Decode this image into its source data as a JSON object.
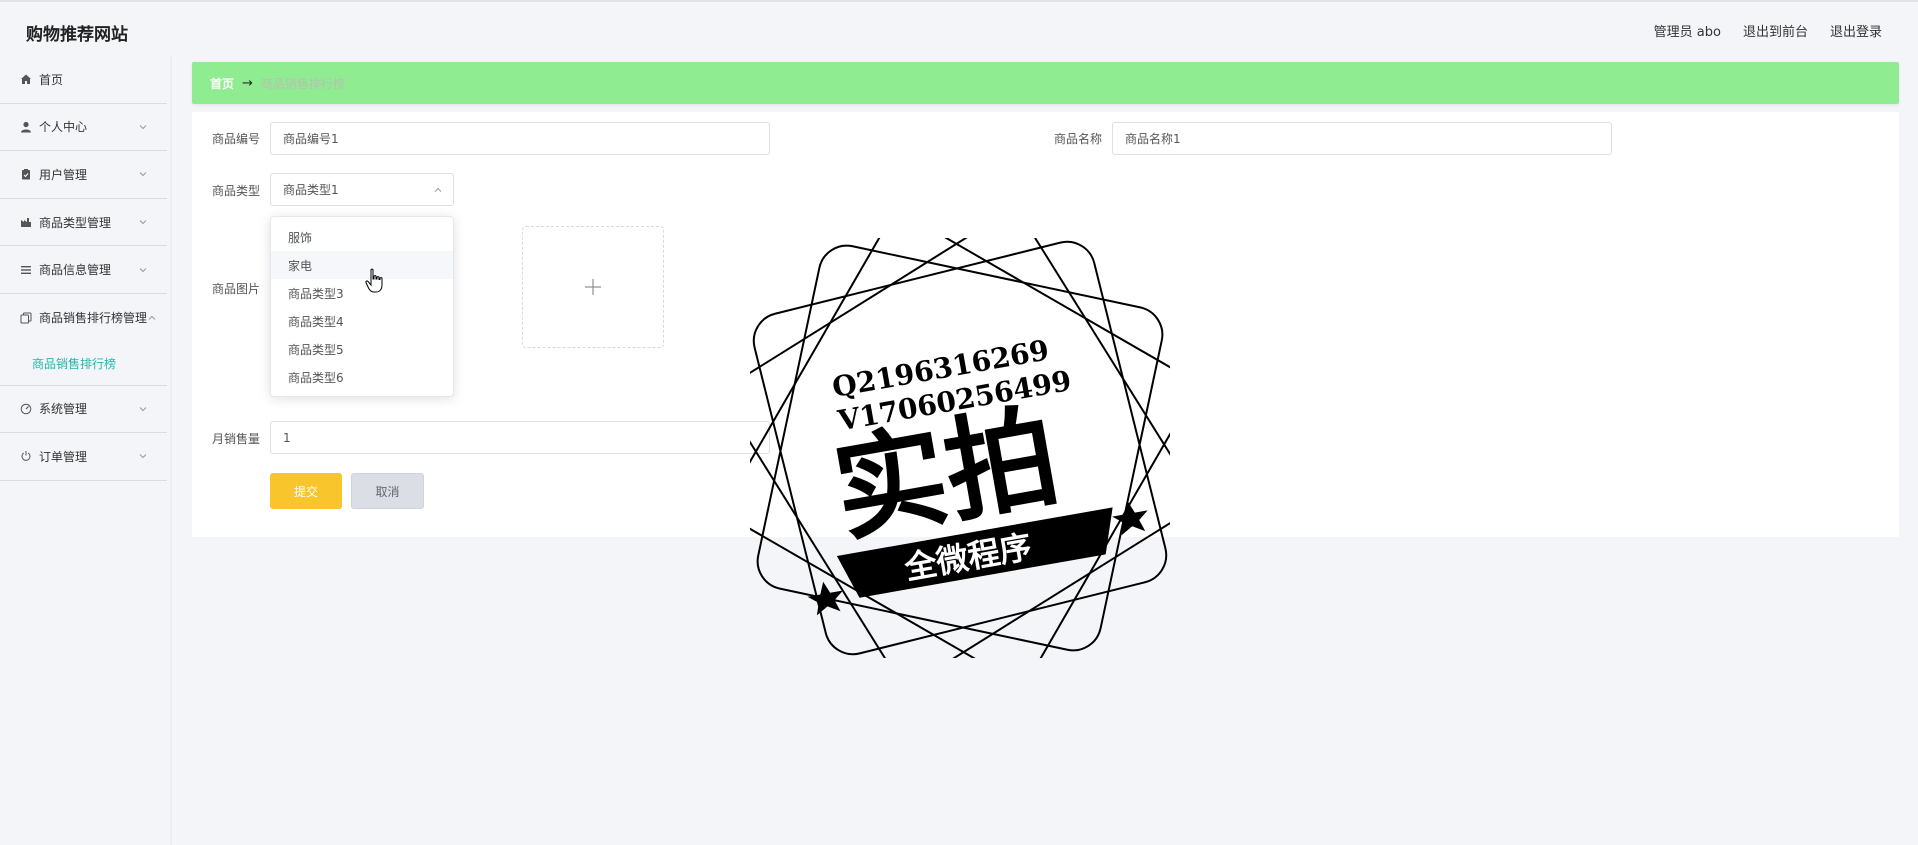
{
  "app": {
    "title": "购物推荐网站"
  },
  "header": {
    "admin_label": "管理员 abo",
    "front_link": "退出到前台",
    "logout_link": "退出登录"
  },
  "sidebar": {
    "items": [
      {
        "label": "首页",
        "icon": "home-icon"
      },
      {
        "label": "个人中心",
        "icon": "user-icon"
      },
      {
        "label": "用户管理",
        "icon": "clipboard-icon"
      },
      {
        "label": "商品类型管理",
        "icon": "factory-icon"
      },
      {
        "label": "商品信息管理",
        "icon": "list-icon"
      },
      {
        "label": "商品销售排行榜管理",
        "icon": "copy-icon"
      },
      {
        "label": "系统管理",
        "icon": "dashboard-icon"
      },
      {
        "label": "订单管理",
        "icon": "power-icon"
      }
    ],
    "active_sub_item": "商品销售排行榜"
  },
  "breadcrumb": {
    "home": "首页",
    "arrow": "→",
    "current": "商品销售排行榜"
  },
  "form": {
    "product_no_label": "商品编号",
    "product_no_value": "商品编号1",
    "product_name_label": "商品名称",
    "product_name_value": "商品名称1",
    "product_type_label": "商品类型",
    "product_type_value": "商品类型1",
    "product_image_label": "商品图片",
    "monthly_sales_label": "月销售量",
    "monthly_sales_value": "1",
    "submit_label": "提交",
    "cancel_label": "取消"
  },
  "dropdown": {
    "options": [
      "服饰",
      "家电",
      "商品类型3",
      "商品类型4",
      "商品类型5",
      "商品类型6"
    ],
    "hovered_index": 1
  },
  "watermark": {
    "qq": "Q2196316269",
    "vx": "V17060256499",
    "main_text": "实拍",
    "banner_text": "全微程序"
  },
  "colors": {
    "breadcrumb_bg": "#90ec90",
    "submit_bg": "#f8c52c",
    "active_sub_item": "#22b8a8"
  }
}
